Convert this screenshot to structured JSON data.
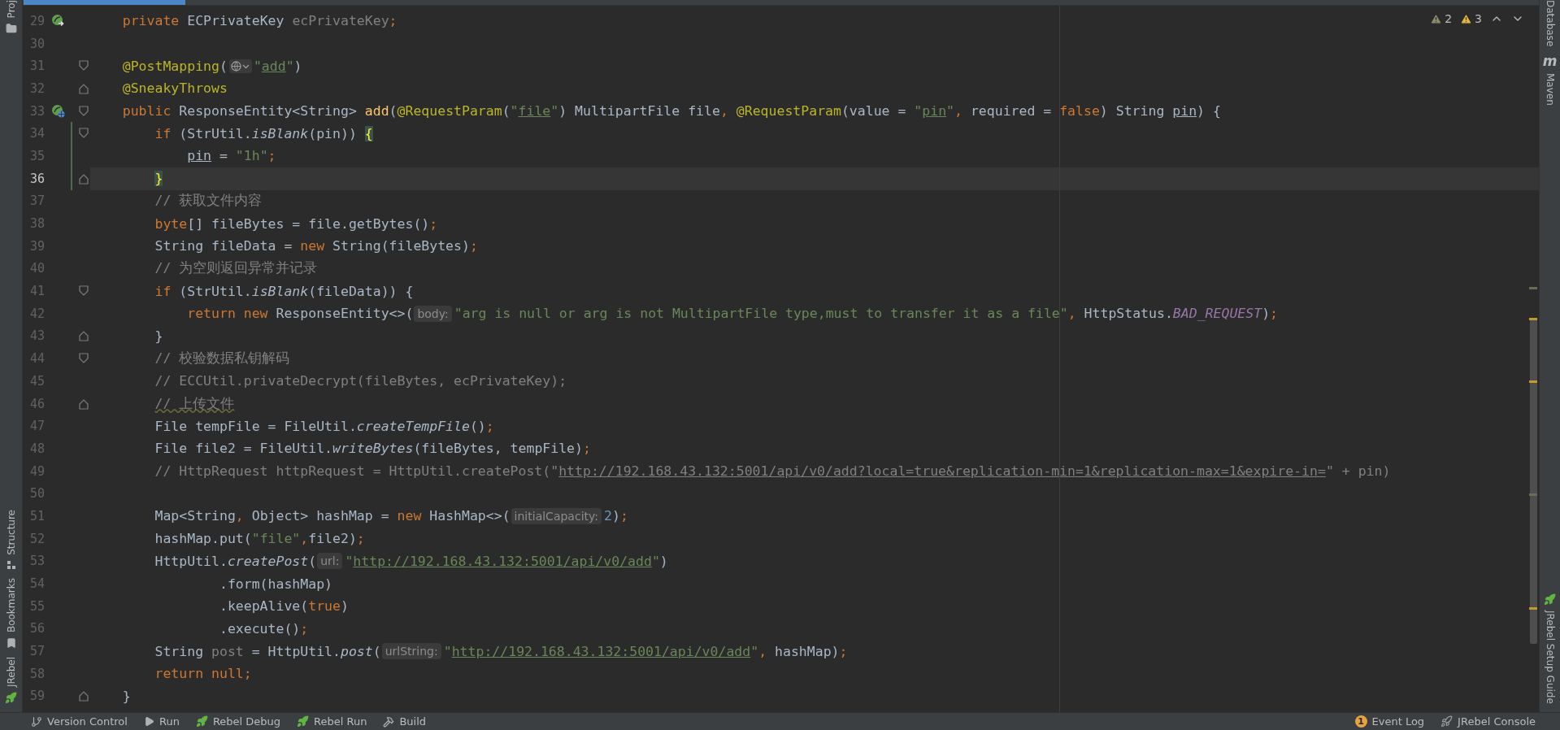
{
  "left_toolbar": {
    "top": [
      {
        "label": "Proj",
        "kind": "folder"
      }
    ],
    "bottom": [
      {
        "label": "Structure",
        "kind": "structure"
      },
      {
        "label": "Bookmarks",
        "kind": "bookmark"
      },
      {
        "label": "JRebel",
        "kind": "rebel"
      }
    ]
  },
  "right_toolbar": {
    "top": [
      {
        "label": "Database"
      },
      {
        "label": "Maven",
        "logo": "m"
      }
    ],
    "bottom": [
      {
        "label": "JRebel Setup Guide",
        "kind": "rebel"
      }
    ]
  },
  "inspections": [
    {
      "kind": "weak",
      "count": "2"
    },
    {
      "kind": "warning",
      "count": "3"
    }
  ],
  "lines": [
    {
      "number": "29",
      "kind": "run",
      "fold_start": false,
      "fold_end": false,
      "changed": false,
      "current": false,
      "tokens": [
        {
          "kind": "keyword",
          "text": "    private"
        },
        {
          "kind": "plain",
          "text": " ECPrivateKey "
        },
        {
          "kind": "unused",
          "text": "ecPrivateKey"
        },
        {
          "kind": "keyword",
          "text": ";"
        }
      ]
    },
    {
      "number": "30",
      "fold_start": false,
      "fold_end": false,
      "changed": false,
      "current": false
    },
    {
      "number": "31",
      "fold_start": true,
      "fold_end": false,
      "changed": false,
      "current": false,
      "tokens": [
        {
          "kind": "annotation",
          "text": "    @PostMapping"
        },
        {
          "kind": "plain",
          "text": "("
        },
        {
          "kind": "globe"
        },
        {
          "kind": "string",
          "text": "\""
        },
        {
          "kind": "string_ref",
          "text": "add"
        },
        {
          "kind": "string",
          "text": "\""
        },
        {
          "kind": "plain",
          "text": ")"
        }
      ]
    },
    {
      "number": "32",
      "fold_start": false,
      "fold_end": true,
      "changed": false,
      "current": false,
      "tokens": [
        {
          "kind": "annotation",
          "text": "    @SneakyThrows"
        }
      ]
    },
    {
      "number": "33",
      "kind": "endpoint",
      "fold_start": true,
      "fold_end": false,
      "changed": false,
      "current": false,
      "tokens": [
        {
          "kind": "keyword",
          "text": "    public"
        },
        {
          "kind": "plain",
          "text": " ResponseEntity<String> "
        },
        {
          "kind": "method_decl",
          "text": "add"
        },
        {
          "kind": "plain",
          "text": "("
        },
        {
          "kind": "annotation",
          "text": "@RequestParam"
        },
        {
          "kind": "plain",
          "text": "("
        },
        {
          "kind": "string",
          "text": "\""
        },
        {
          "kind": "string_ref",
          "text": "file"
        },
        {
          "kind": "string",
          "text": "\""
        },
        {
          "kind": "plain",
          "text": ") MultipartFile file"
        },
        {
          "kind": "keyword",
          "text": ","
        },
        {
          "kind": "annotation",
          "text": " @RequestParam"
        },
        {
          "kind": "plain",
          "text": "(value = "
        },
        {
          "kind": "string",
          "text": "\""
        },
        {
          "kind": "string_ref",
          "text": "pin"
        },
        {
          "kind": "string",
          "text": "\""
        },
        {
          "kind": "keyword",
          "text": ","
        },
        {
          "kind": "plain",
          "text": " required = "
        },
        {
          "kind": "keyword",
          "text": "false"
        },
        {
          "kind": "plain",
          "text": ") String "
        },
        {
          "kind": "var_ref",
          "text": "pin"
        },
        {
          "kind": "plain",
          "text": ") {"
        }
      ]
    },
    {
      "number": "34",
      "fold_start": true,
      "fold_end": false,
      "changed": true,
      "current": false,
      "tokens": [
        {
          "kind": "keyword",
          "text": "        if"
        },
        {
          "kind": "plain",
          "text": " (StrUtil."
        },
        {
          "kind": "static",
          "text": "isBlank"
        },
        {
          "kind": "plain",
          "text": "(pin)) "
        },
        {
          "kind": "brace",
          "text": "{"
        }
      ]
    },
    {
      "number": "35",
      "fold_start": false,
      "fold_end": false,
      "changed": true,
      "current": false,
      "tokens": [
        {
          "kind": "var_ref",
          "text": "            pin"
        },
        {
          "kind": "plain",
          "text": " = "
        },
        {
          "kind": "string",
          "text": "\"1h\""
        },
        {
          "kind": "keyword",
          "text": ";"
        }
      ]
    },
    {
      "number": "36",
      "fold_start": false,
      "fold_end": true,
      "changed": true,
      "current": true,
      "tokens": [
        {
          "kind": "brace",
          "text": "        }"
        }
      ]
    },
    {
      "number": "37",
      "fold_start": false,
      "fold_end": false,
      "changed": false,
      "current": false,
      "tokens": [
        {
          "kind": "comment",
          "text": "        // 获取文件内容"
        }
      ]
    },
    {
      "number": "38",
      "fold_start": false,
      "fold_end": false,
      "changed": false,
      "current": false,
      "tokens": [
        {
          "kind": "keyword",
          "text": "        byte"
        },
        {
          "kind": "plain",
          "text": "[] fileBytes = file.getBytes()"
        },
        {
          "kind": "keyword",
          "text": ";"
        }
      ]
    },
    {
      "number": "39",
      "fold_start": false,
      "fold_end": false,
      "changed": false,
      "current": false,
      "tokens": [
        {
          "kind": "plain",
          "text": "        String fileData = "
        },
        {
          "kind": "keyword",
          "text": "new"
        },
        {
          "kind": "plain",
          "text": " String(fileBytes)"
        },
        {
          "kind": "keyword",
          "text": ";"
        }
      ]
    },
    {
      "number": "40",
      "fold_start": false,
      "fold_end": false,
      "changed": false,
      "current": false,
      "tokens": [
        {
          "kind": "comment",
          "text": "        // 为空则返回异常并记录"
        }
      ]
    },
    {
      "number": "41",
      "fold_start": true,
      "fold_end": false,
      "changed": false,
      "current": false,
      "tokens": [
        {
          "kind": "keyword",
          "text": "        if"
        },
        {
          "kind": "plain",
          "text": " (StrUtil."
        },
        {
          "kind": "static",
          "text": "isBlank"
        },
        {
          "kind": "plain",
          "text": "(fileData)) {"
        }
      ]
    },
    {
      "number": "42",
      "fold_start": false,
      "fold_end": false,
      "changed": false,
      "current": false,
      "tokens": [
        {
          "kind": "keyword",
          "text": "            return new"
        },
        {
          "kind": "plain",
          "text": " ResponseEntity<>("
        },
        {
          "kind": "hint",
          "text": "body:"
        },
        {
          "kind": "string",
          "text": "\"arg is null or arg is not MultipartFile type,must to transfer it as a file\""
        },
        {
          "kind": "keyword",
          "text": ","
        },
        {
          "kind": "plain",
          "text": " HttpStatus."
        },
        {
          "kind": "constant",
          "text": "BAD_REQUEST"
        },
        {
          "kind": "plain",
          "text": ")"
        },
        {
          "kind": "keyword",
          "text": ";"
        }
      ]
    },
    {
      "number": "43",
      "fold_start": false,
      "fold_end": true,
      "changed": false,
      "current": false,
      "tokens": [
        {
          "kind": "plain",
          "text": "        }"
        }
      ]
    },
    {
      "number": "44",
      "fold_start": true,
      "fold_end": false,
      "changed": false,
      "current": false,
      "tokens": [
        {
          "kind": "comment",
          "text": "        // 校验数据私钥解码"
        }
      ]
    },
    {
      "number": "45",
      "fold_start": false,
      "fold_end": false,
      "changed": false,
      "current": false,
      "tokens": [
        {
          "kind": "comment",
          "text": "        // ECCUtil.privateDecrypt(fileBytes, ecPrivateKey);"
        }
      ]
    },
    {
      "number": "46",
      "fold_start": false,
      "fold_end": true,
      "changed": false,
      "current": false,
      "tokens": [
        {
          "kind": "comment_typo",
          "text": "        // 上传文件"
        }
      ]
    },
    {
      "number": "47",
      "fold_start": false,
      "fold_end": false,
      "changed": false,
      "current": false,
      "tokens": [
        {
          "kind": "plain",
          "text": "        File tempFile = FileUtil."
        },
        {
          "kind": "static",
          "text": "createTempFile"
        },
        {
          "kind": "plain",
          "text": "()"
        },
        {
          "kind": "keyword",
          "text": ";"
        }
      ]
    },
    {
      "number": "48",
      "fold_start": false,
      "fold_end": false,
      "changed": false,
      "current": false,
      "tokens": [
        {
          "kind": "plain",
          "text": "        File file2 = FileUtil."
        },
        {
          "kind": "static",
          "text": "writeBytes"
        },
        {
          "kind": "plain",
          "text": "(fileBytes, tempFile)"
        },
        {
          "kind": "keyword",
          "text": ";"
        }
      ]
    },
    {
      "number": "49",
      "fold_start": false,
      "fold_end": false,
      "changed": false,
      "current": false,
      "tokens": [
        {
          "kind": "comment",
          "text": "        // HttpRequest httpRequest = HttpUtil.createPost(\""
        },
        {
          "kind": "comment_ref",
          "text": "http://192.168.43.132:5001/api/v0/add?local=true&replication-min=1&replication-max=1&expire-in="
        },
        {
          "kind": "comment",
          "text": "\" + pin)"
        }
      ]
    },
    {
      "number": "50",
      "fold_start": false,
      "fold_end": false,
      "changed": false,
      "current": false
    },
    {
      "number": "51",
      "fold_start": false,
      "fold_end": false,
      "changed": false,
      "current": false,
      "tokens": [
        {
          "kind": "plain",
          "text": "        Map<String"
        },
        {
          "kind": "keyword",
          "text": ","
        },
        {
          "kind": "plain",
          "text": " Object> hashMap = "
        },
        {
          "kind": "keyword",
          "text": "new"
        },
        {
          "kind": "plain",
          "text": " HashMap<>("
        },
        {
          "kind": "hint",
          "text": "initialCapacity:"
        },
        {
          "kind": "number",
          "text": "2"
        },
        {
          "kind": "plain",
          "text": ")"
        },
        {
          "kind": "keyword",
          "text": ";"
        }
      ]
    },
    {
      "number": "52",
      "fold_start": false,
      "fold_end": false,
      "changed": false,
      "current": false,
      "tokens": [
        {
          "kind": "plain",
          "text": "        hashMap.put("
        },
        {
          "kind": "string",
          "text": "\"file\""
        },
        {
          "kind": "keyword",
          "text": ","
        },
        {
          "kind": "plain",
          "text": "file2)"
        },
        {
          "kind": "keyword",
          "text": ";"
        }
      ]
    },
    {
      "number": "53",
      "fold_start": false,
      "fold_end": false,
      "changed": false,
      "current": false,
      "tokens": [
        {
          "kind": "plain",
          "text": "        HttpUtil."
        },
        {
          "kind": "static",
          "text": "createPost"
        },
        {
          "kind": "plain",
          "text": "("
        },
        {
          "kind": "hint",
          "text": "url:"
        },
        {
          "kind": "string",
          "text": "\""
        },
        {
          "kind": "string_ref",
          "text": "http://192.168.43.132:5001/api/v0/add"
        },
        {
          "kind": "string",
          "text": "\""
        },
        {
          "kind": "plain",
          "text": ")"
        }
      ]
    },
    {
      "number": "54",
      "fold_start": false,
      "fold_end": false,
      "changed": false,
      "current": false,
      "tokens": [
        {
          "kind": "plain",
          "text": "                .form(hashMap)"
        }
      ]
    },
    {
      "number": "55",
      "fold_start": false,
      "fold_end": false,
      "changed": false,
      "current": false,
      "tokens": [
        {
          "kind": "plain",
          "text": "                .keepAlive("
        },
        {
          "kind": "keyword",
          "text": "true"
        },
        {
          "kind": "plain",
          "text": ")"
        }
      ]
    },
    {
      "number": "56",
      "fold_start": false,
      "fold_end": false,
      "changed": false,
      "current": false,
      "tokens": [
        {
          "kind": "plain",
          "text": "                .execute()"
        },
        {
          "kind": "keyword",
          "text": ";"
        }
      ]
    },
    {
      "number": "57",
      "fold_start": false,
      "fold_end": false,
      "changed": false,
      "current": false,
      "tokens": [
        {
          "kind": "plain",
          "text": "        String "
        },
        {
          "kind": "unused",
          "text": "post"
        },
        {
          "kind": "plain",
          "text": " = HttpUtil."
        },
        {
          "kind": "static",
          "text": "post"
        },
        {
          "kind": "plain",
          "text": "("
        },
        {
          "kind": "hint",
          "text": "urlString:"
        },
        {
          "kind": "string",
          "text": "\""
        },
        {
          "kind": "string_ref",
          "text": "http://192.168.43.132:5001/api/v0/add"
        },
        {
          "kind": "string",
          "text": "\""
        },
        {
          "kind": "keyword",
          "text": ","
        },
        {
          "kind": "plain",
          "text": " hashMap)"
        },
        {
          "kind": "keyword",
          "text": ";"
        }
      ]
    },
    {
      "number": "58",
      "fold_start": false,
      "fold_end": false,
      "changed": false,
      "current": false,
      "tokens": [
        {
          "kind": "keyword",
          "text": "        return null;"
        }
      ]
    },
    {
      "number": "59",
      "fold_start": false,
      "fold_end": true,
      "changed": false,
      "current": false,
      "tokens": [
        {
          "kind": "plain",
          "text": "    }"
        }
      ]
    }
  ],
  "bottom_bar": {
    "left": [
      {
        "label": "Version Control",
        "kind": "branch"
      },
      {
        "label": "Run",
        "kind": "play"
      },
      {
        "label": "Rebel Debug",
        "kind": "rebel"
      },
      {
        "label": "Rebel Run",
        "kind": "rebel"
      },
      {
        "label": "Build",
        "kind": "hammer"
      }
    ],
    "right": [
      {
        "label": "Event Log",
        "badge": "1"
      },
      {
        "label": "JRebel Console",
        "kind": "rebel_grey"
      }
    ]
  }
}
